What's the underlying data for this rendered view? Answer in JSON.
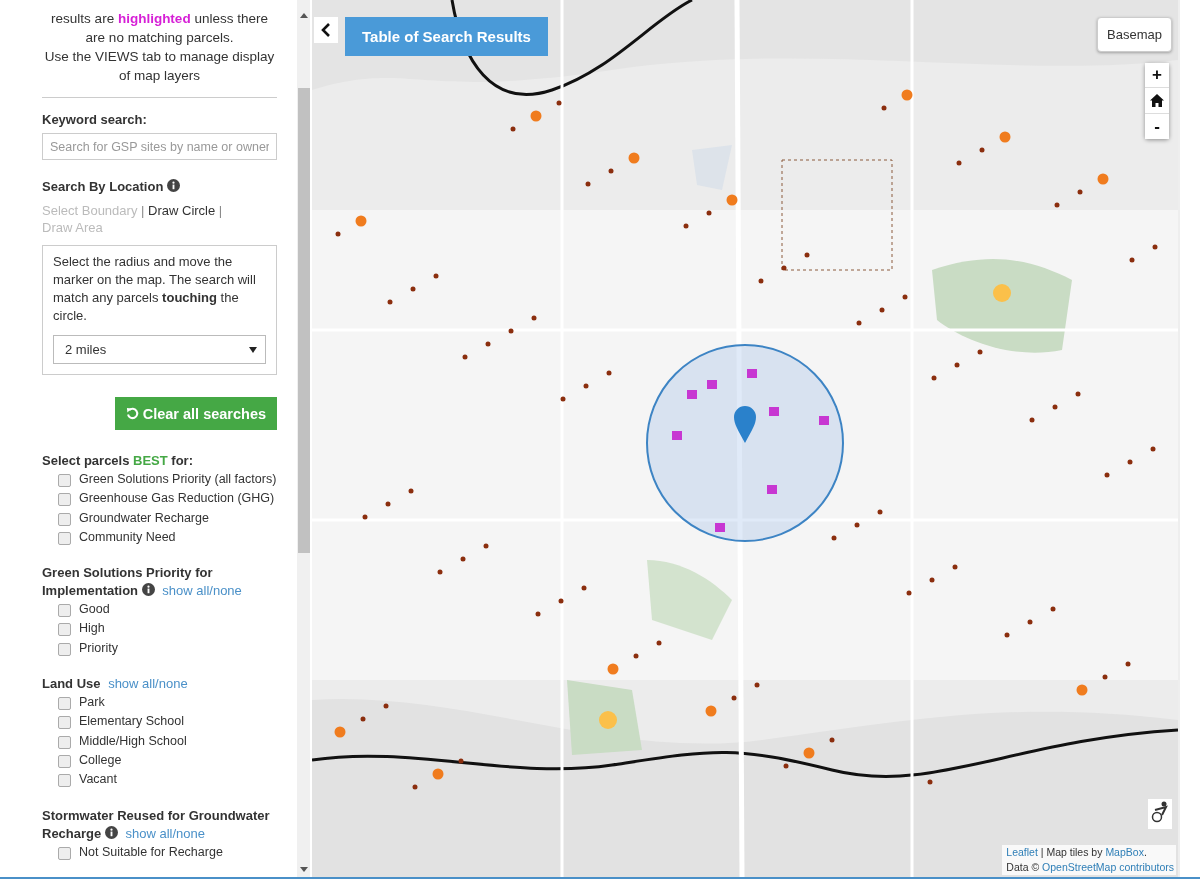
{
  "intro": [
    "results are **highlighted** unless there are no matching parcels.",
    "Use the VIEWS tab to manage display of map layers"
  ],
  "keyword_search": {
    "label": "Keyword search:",
    "placeholder": "Search for GSP sites by name or owner"
  },
  "location": {
    "label": "Search By Location",
    "info": true,
    "separator": "|",
    "modes": [
      {
        "label": "Select Boundary",
        "selected": false
      },
      {
        "label": "Draw Circle",
        "selected": true
      },
      {
        "label": "Draw Area",
        "selected": false
      }
    ],
    "instructions": "Select the radius and move the marker on the map. The search will match any parcels **touching** the circle.",
    "radius": "2 miles"
  },
  "clear_button": "Clear all searches",
  "filter_groups": [
    {
      "title": "Select parcels **BEST** for:",
      "info": false,
      "options": [
        {
          "label": "Green Solutions Priority (all factors)",
          "checked": false
        },
        {
          "label": "Greenhouse Gas Reduction (GHG)",
          "checked": false
        },
        {
          "label": "Groundwater Recharge",
          "checked": false
        },
        {
          "label": "Community Need",
          "checked": false
        }
      ]
    },
    {
      "title": "Green Solutions Priority for Implementation",
      "info": true,
      "toggle": "show all/none",
      "options": [
        {
          "label": "Good",
          "checked": false
        },
        {
          "label": "High",
          "checked": false
        },
        {
          "label": "Priority",
          "checked": false
        }
      ]
    },
    {
      "title": "Land Use",
      "info": false,
      "toggle": "show all/none",
      "options": [
        {
          "label": "Park",
          "checked": false
        },
        {
          "label": "Elementary School",
          "checked": false
        },
        {
          "label": "Middle/High School",
          "checked": false
        },
        {
          "label": "College",
          "checked": false
        },
        {
          "label": "Vacant",
          "checked": false
        }
      ]
    },
    {
      "title": "Stormwater Reused for Groundwater Recharge",
      "info": true,
      "toggle": "show all/none",
      "options": [
        {
          "label": "Not Suitable for Recharge",
          "checked": false
        }
      ]
    }
  ],
  "map": {
    "table_button": "Table of Search Results",
    "basemap_button": "Basemap",
    "zoom_in": "+",
    "zoom_out": "-",
    "attribution": [
      {
        "text": "Leaflet",
        "link": true
      },
      {
        "text": " | Map tiles by "
      },
      {
        "text": "MapBox",
        "link": true
      },
      {
        "text": "."
      }
    ],
    "attribution_line2": [
      {
        "text": "Data © "
      },
      {
        "text": "OpenStreetMap contributors",
        "link": true
      }
    ]
  }
}
